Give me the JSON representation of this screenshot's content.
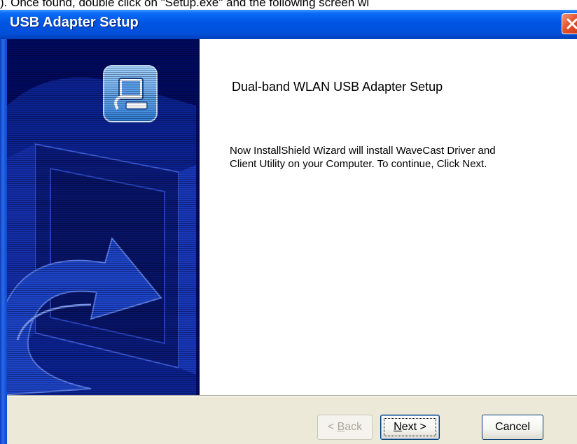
{
  "document_text": "). Once found, double click on \"Setup.exe\" and the following screen wi",
  "window": {
    "title": "USB Adapter Setup",
    "close_label": "✕"
  },
  "content": {
    "heading": "Dual-band WLAN USB Adapter Setup",
    "description": "Now InstallShield Wizard will install WaveCast Driver and\nClient Utility on your Computer. To continue, Click Next."
  },
  "buttons": {
    "back": {
      "prefix": "< ",
      "accel": "B",
      "rest": "ack",
      "enabled": false
    },
    "next": {
      "accel": "N",
      "rest": "ext >",
      "enabled": true,
      "default": true
    },
    "cancel": {
      "label": "Cancel",
      "enabled": true
    }
  },
  "colors": {
    "titlebar": "#0054e3",
    "left_panel": "#000a5e",
    "dialog_face": "#ece9d8",
    "close_button": "#e2532f"
  },
  "icons": [
    "setup-computer-icon",
    "close-icon",
    "installer-graphic"
  ]
}
